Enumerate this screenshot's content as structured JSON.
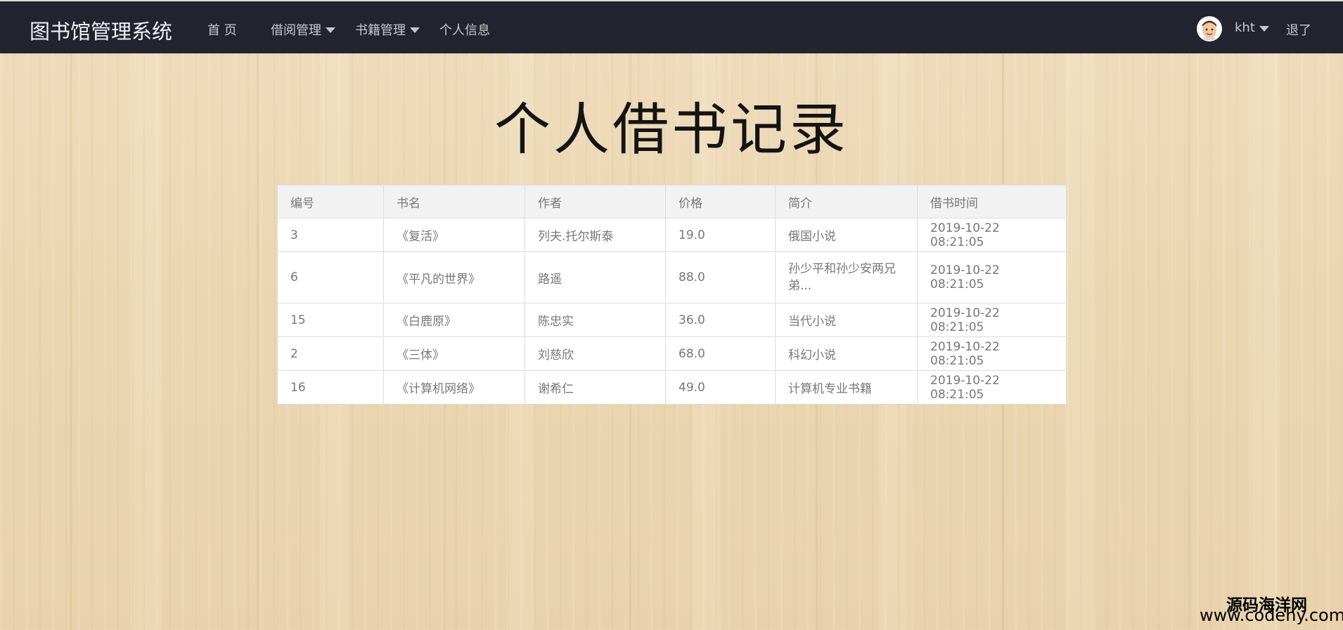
{
  "nav": {
    "brand": "图书馆管理系统",
    "home": "首 页",
    "borrow_menu": "借阅管理",
    "books_menu": "书籍管理",
    "profile": "个人信息",
    "username": "kht",
    "logout": "退了",
    "avatar_icon": "user-avatar-icon"
  },
  "page": {
    "title": "个人借书记录"
  },
  "table": {
    "headers": [
      "编号",
      "书名",
      "作者",
      "价格",
      "简介",
      "借书时间"
    ],
    "rows": [
      [
        "3",
        "《复活》",
        "列夫.托尔斯泰",
        "19.0",
        "俄国小说",
        "2019-10-22 08:21:05"
      ],
      [
        "6",
        "《平凡的世界》",
        "路遥",
        "88.0",
        "孙少平和孙少安两兄弟...",
        "2019-10-22 08:21:05"
      ],
      [
        "15",
        "《白鹿原》",
        "陈忠实",
        "36.0",
        "当代小说",
        "2019-10-22 08:21:05"
      ],
      [
        "2",
        "《三体》",
        "刘慈欣",
        "68.0",
        "科幻小说",
        "2019-10-22 08:21:05"
      ],
      [
        "16",
        "《计算机网络》",
        "谢希仁",
        "49.0",
        "计算机专业书籍",
        "2019-10-22 08:21:05"
      ]
    ]
  },
  "watermark": {
    "name": "源码海洋网",
    "url": "www.codehy.com"
  }
}
